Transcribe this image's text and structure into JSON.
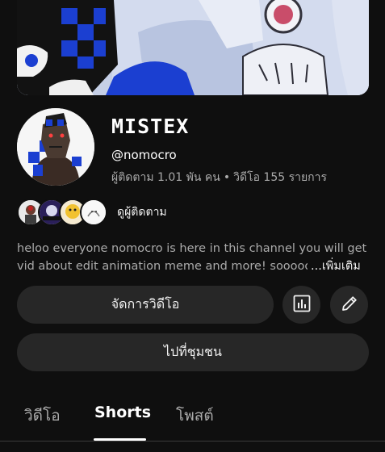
{
  "channel": {
    "name": "MISTEX",
    "handle": "@nomocro",
    "subscribers": "ผู้ติดตาม 1.01 พัน คน",
    "separator": "•",
    "videos": "วิดีโอ 155 รายการ"
  },
  "subscribers_row": {
    "label": "ดูผู้ติดตาม"
  },
  "description": {
    "line1": "heloo everyone nomocro is here in this channel you will get",
    "line2": "vid about edit animation meme and more! soooooo",
    "more": "...เพิ่มเติม"
  },
  "buttons": {
    "manage_videos": "จัดการวิดีโอ",
    "community": "ไปที่ชุมชน"
  },
  "tabs": [
    {
      "label": "วิดีโอ",
      "active": false
    },
    {
      "label": "Shorts",
      "active": true
    },
    {
      "label": "โพสต์",
      "active": false
    }
  ],
  "colors": {
    "background": "#0f0f0f",
    "button_bg": "#272727",
    "secondary_text": "#aaaaaa",
    "banner_blue": "#1b3fd1"
  },
  "icons": {
    "analytics": "bar-chart-icon",
    "edit": "pencil-icon"
  }
}
